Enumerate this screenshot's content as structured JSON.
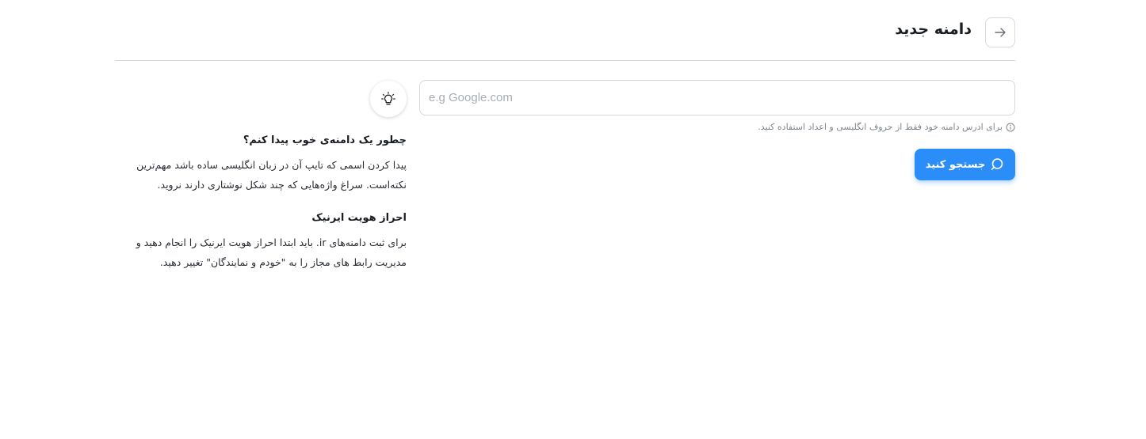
{
  "header": {
    "title": "دامنه جدید",
    "back_icon": "arrow-right-icon"
  },
  "search": {
    "placeholder": "e.g Google.com",
    "value": "",
    "hint": "برای ادرس دامنه خود فقط از حروف انگلیسی و اعداد استفاده کنید.",
    "hint_icon": "info-circle-icon",
    "button_label": "جستجو کنید",
    "button_icon": "search-icon",
    "button_color": "#2b8ef8"
  },
  "tips": {
    "icon": "lightbulb-icon",
    "items": [
      {
        "title": "چطور یک دامنه‌ی خوب پیدا کنم؟",
        "body": "پیدا کردن اسمی که تایپ آن در زبان انگلیسی ساده باشد مهم‌ترین نکته‌است. سراغ واژه‌هایی که چند شکل نوشتاری دارند نروید."
      },
      {
        "title": "احراز هویت ایرنیک",
        "body": "برای ثبت دامنه‌های ir. باید ابتدا احراز هویت ایرنیک را انجام دهید و مدیریت رابط های مجاز را به \"خودم و نمایندگان\" تغییر دهید."
      }
    ]
  }
}
